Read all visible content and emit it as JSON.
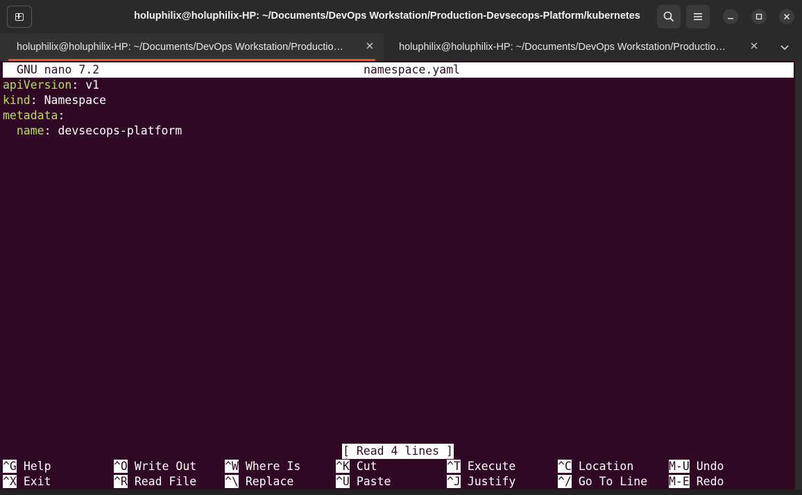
{
  "window": {
    "title": "holuphilix@holuphilix-HP: ~/Documents/DevOps Workstation/Production-Devsecops-Platform/kubernetes"
  },
  "tabs": [
    {
      "label": "holuphilix@holuphilix-HP: ~/Documents/DevOps Workstation/Productio…"
    },
    {
      "label": "holuphilix@holuphilix-HP: ~/Documents/DevOps Workstation/Productio…"
    }
  ],
  "icons": {
    "new_tab": "new-tab-icon",
    "search": "search-icon",
    "menu": "hamburger-menu-icon",
    "minimize": "minimize-icon",
    "maximize": "maximize-icon",
    "close": "close-icon",
    "tab_close": "close-icon",
    "tab_list": "chevron-down-icon"
  },
  "nano": {
    "version": "GNU nano 7.2",
    "filename": "namespace.yaml",
    "status": "[ Read 4 lines ]",
    "lines": [
      {
        "key": "apiVersion",
        "value": ": v1",
        "indent": ""
      },
      {
        "key": "kind",
        "value": ": Namespace",
        "indent": ""
      },
      {
        "key": "metadata",
        "value": ":",
        "indent": ""
      },
      {
        "key": "name",
        "value": ": devsecops-platform",
        "indent": "  "
      }
    ],
    "shortcuts": [
      {
        "key": "^G",
        "label": "Help"
      },
      {
        "key": "^O",
        "label": "Write Out"
      },
      {
        "key": "^W",
        "label": "Where Is"
      },
      {
        "key": "^K",
        "label": "Cut"
      },
      {
        "key": "^T",
        "label": "Execute"
      },
      {
        "key": "^C",
        "label": "Location"
      },
      {
        "key": "M-U",
        "label": "Undo"
      },
      {
        "key": "^X",
        "label": "Exit"
      },
      {
        "key": "^R",
        "label": "Read File"
      },
      {
        "key": "^\\",
        "label": "Replace"
      },
      {
        "key": "^U",
        "label": "Paste"
      },
      {
        "key": "^J",
        "label": "Justify"
      },
      {
        "key": "^/",
        "label": "Go To Line"
      },
      {
        "key": "M-E",
        "label": "Redo"
      }
    ]
  },
  "colors": {
    "terminal_bg": "#300a24",
    "syntax_key": "#b6e04f",
    "accent": "#e95420"
  }
}
